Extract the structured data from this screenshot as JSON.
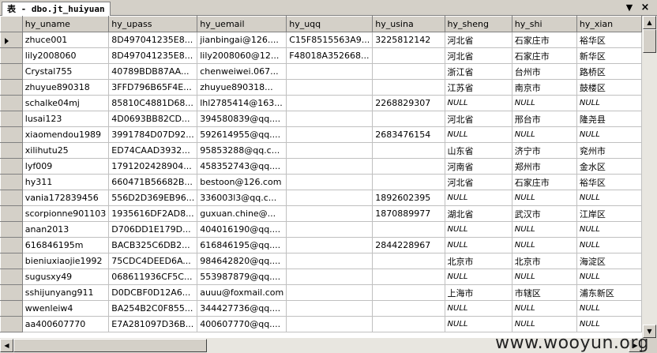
{
  "window": {
    "tab_title": "表 - dbo.jt_huiyuan"
  },
  "columns": [
    "hy_uname",
    "hy_upass",
    "hy_uemail",
    "hy_uqq",
    "hy_usina",
    "hy_sheng",
    "hy_shi",
    "hy_xian"
  ],
  "rows": [
    [
      "zhuce001",
      "8D497041235E8...",
      "jianbingai@126....",
      "C15F8515563A9...",
      "3225812142",
      "河北省",
      "石家庄市",
      "裕华区"
    ],
    [
      "lily2008060",
      "8D497041235E8...",
      "lily2008060@12...",
      "F48018A352668...",
      "",
      "河北省",
      "石家庄市",
      "新华区"
    ],
    [
      "Crystal755",
      "40789BDB87AA...",
      "chenweiwei.067...",
      "",
      "",
      "浙江省",
      "台州市",
      "路桥区"
    ],
    [
      "zhuyue890318",
      "3FFD796B65F4E...",
      "zhuyue890318...",
      "",
      "",
      "江苏省",
      "南京市",
      "鼓楼区"
    ],
    [
      "schalke04mj",
      "85810C4881D68...",
      "lhl2785414@163...",
      "",
      "2268829307",
      "NULL",
      "NULL",
      "NULL"
    ],
    [
      "lusai123",
      "4D0693BB82CD...",
      "394580839@qq....",
      "",
      "",
      "河北省",
      "邢台市",
      "隆尧县"
    ],
    [
      "xiaomendou1989",
      "3991784D07D92...",
      "592614955@qq....",
      "",
      "2683476154",
      "NULL",
      "NULL",
      "NULL"
    ],
    [
      "xilihutu25",
      "ED74CAAD3932...",
      "95853288@qq.c...",
      "",
      "",
      "山东省",
      "济宁市",
      "兖州市"
    ],
    [
      "lyf009",
      "1791202428904...",
      "458352743@qq....",
      "",
      "",
      "河南省",
      "郑州市",
      "金水区"
    ],
    [
      "hy311",
      "660471B56682B...",
      "bestoon@126.com",
      "",
      "",
      "河北省",
      "石家庄市",
      "裕华区"
    ],
    [
      "vania172839456",
      "556D2D369EB96...",
      "336003l3@qq.c...",
      "",
      "1892602395",
      "NULL",
      "NULL",
      "NULL"
    ],
    [
      "scorpionne901103",
      "1935616DF2AD8...",
      "guxuan.chine@...",
      "",
      "1870889977",
      "湖北省",
      "武汉市",
      "江岸区"
    ],
    [
      "anan2013",
      "D706DD1E179D...",
      "404016190@qq....",
      "",
      "",
      "NULL",
      "NULL",
      "NULL"
    ],
    [
      "616846195m",
      "BACB325C6DB2...",
      "616846195@qq....",
      "",
      "2844228967",
      "NULL",
      "NULL",
      "NULL"
    ],
    [
      "bieniuxiaojie1992",
      "75CDC4DEED6A...",
      "984642820@qq....",
      "",
      "",
      "北京市",
      "北京市",
      "海淀区"
    ],
    [
      "sugusxy49",
      "068611936CF5C...",
      "553987879@qq....",
      "",
      "",
      "NULL",
      "NULL",
      "NULL"
    ],
    [
      "sshijunyang911",
      "D0DCBF0D12A6...",
      "auuu@foxmail.com",
      "",
      "",
      "上海市",
      "市辖区",
      "浦东新区"
    ],
    [
      "wwenleiw4",
      "BA254B2C0F855...",
      "344427736@qq....",
      "",
      "",
      "NULL",
      "NULL",
      "NULL"
    ],
    [
      "aa400607770",
      "E7A281097D36B...",
      "400607770@qq....",
      "",
      "",
      "NULL",
      "NULL",
      "NULL"
    ]
  ],
  "null_label": "NULL",
  "watermark": "www.wooyun.org"
}
